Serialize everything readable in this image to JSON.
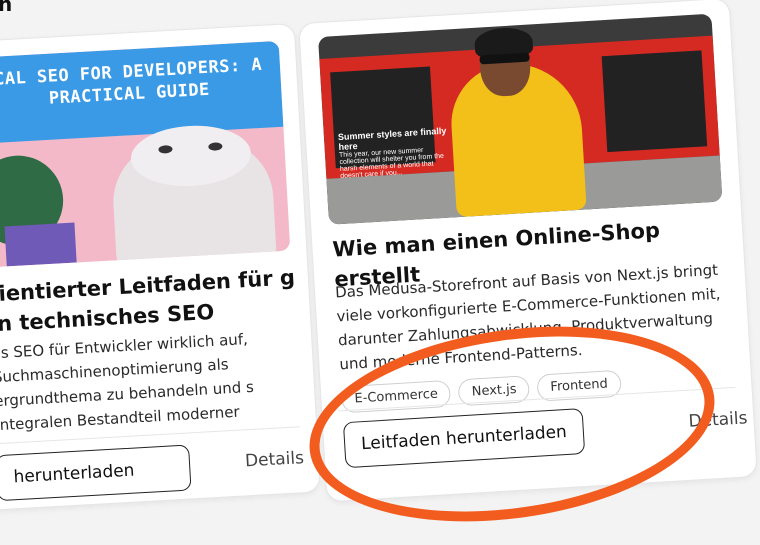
{
  "page": {
    "heading_fragment": "n"
  },
  "cards": [
    {
      "cover": {
        "banner": "CAL SEO FOR DEVELOPERS: A PRACTICAL GUIDE"
      },
      "title": "rientierter Leitfaden für g in technisches SEO",
      "description": "es SEO für Entwickler wirklich auf, Suchmaschinenoptimierung als ergrundthema zu behandeln und s integralen Bestandteil moderner",
      "download_label": "herunterladen",
      "details_label": "Details"
    },
    {
      "cover": {
        "headline": "Summer styles are finally here",
        "subtext": "This year, our new summer collection will shelter you from the harsh elements of a world that doesn't care if you..."
      },
      "title": "Wie man einen Online-Shop erstellt",
      "description": "Das Medusa-Storefront auf Basis von Next.js bringt viele vorkonfigurierte E-Commerce-Funktionen mit, darunter Zahlungsabwicklung, Produktverwaltung und moderne Frontend-Patterns.",
      "tags": [
        "E-Commerce",
        "Next.js",
        "Frontend"
      ],
      "download_label": "Leitfaden herunterladen",
      "details_label": "Details"
    }
  ],
  "colors": {
    "annotation": "#f25c1e",
    "banner": "#3b9ae6",
    "storefront": "#d52a22",
    "jacket": "#f2c018"
  }
}
